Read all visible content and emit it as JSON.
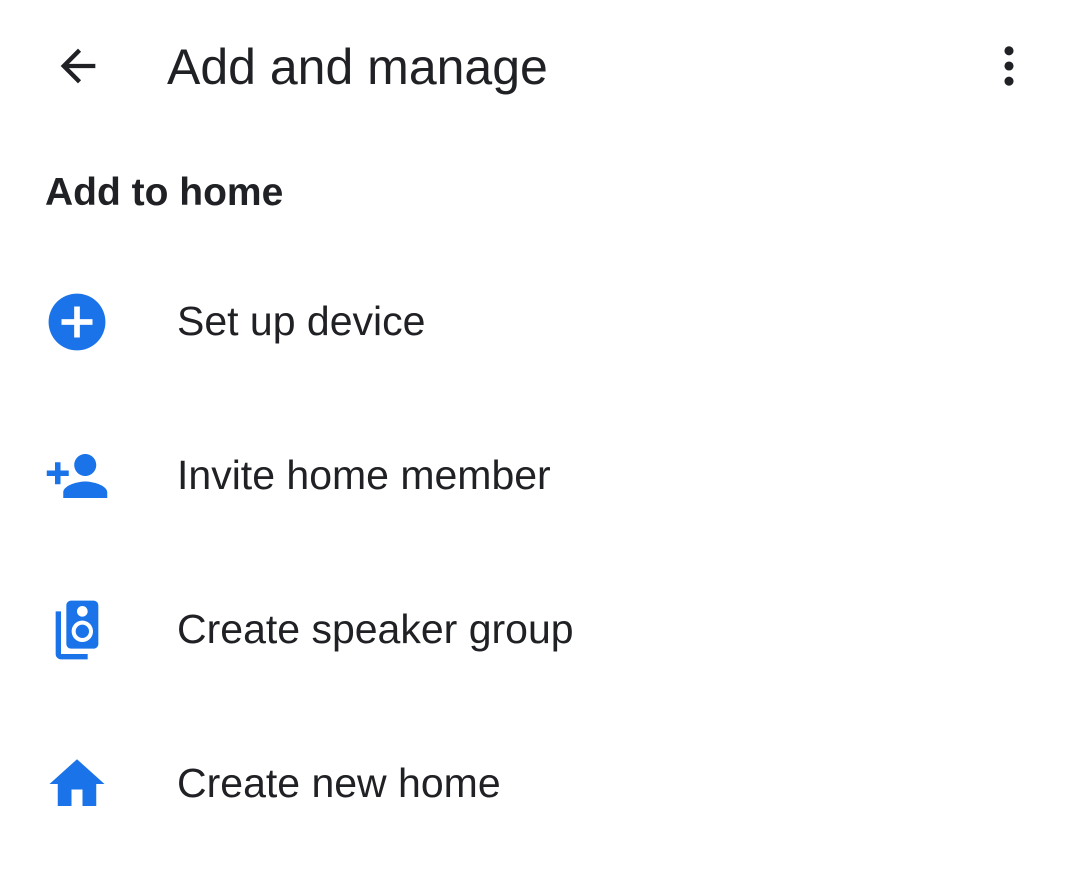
{
  "theme": {
    "accent": "#1a73e8",
    "text": "#202124",
    "background": "#ffffff"
  },
  "app_bar": {
    "back_icon": "arrow-back-icon",
    "title": "Add and manage",
    "overflow_icon": "more-vert-icon"
  },
  "section": {
    "header": "Add to home"
  },
  "menu": {
    "items": [
      {
        "icon": "add-circle-icon",
        "label": "Set up device"
      },
      {
        "icon": "person-add-icon",
        "label": "Invite home member"
      },
      {
        "icon": "speaker-group-icon",
        "label": "Create speaker group"
      },
      {
        "icon": "home-icon",
        "label": "Create new home"
      }
    ]
  }
}
